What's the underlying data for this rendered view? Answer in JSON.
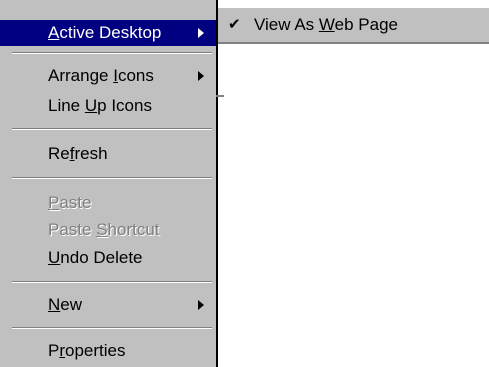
{
  "context_menu": {
    "active_desktop": {
      "prefix": "",
      "hotkey": "A",
      "rest": "ctive Desktop"
    },
    "arrange_icons": {
      "prefix": "Arrange ",
      "hotkey": "I",
      "rest": "cons"
    },
    "line_up_icons": {
      "prefix": "Line ",
      "hotkey": "U",
      "rest": "p Icons"
    },
    "refresh": {
      "prefix": "Re",
      "hotkey": "f",
      "rest": "resh"
    },
    "paste": {
      "prefix": "",
      "hotkey": "P",
      "rest": "aste"
    },
    "paste_shortcut": {
      "prefix": "Paste ",
      "hotkey": "S",
      "rest": "hortcut"
    },
    "undo_delete": {
      "prefix": "",
      "hotkey": "U",
      "rest": "ndo Delete"
    },
    "new": {
      "prefix": "",
      "hotkey": "N",
      "rest": "ew"
    },
    "properties": {
      "prefix": "P",
      "hotkey": "r",
      "rest": "operties"
    }
  },
  "submenu": {
    "check_glyph": "✔",
    "view_as_web_page": {
      "prefix": "View As ",
      "hotkey": "W",
      "rest": "eb Page"
    }
  },
  "colors": {
    "menu_bg": "#c0c0c0",
    "highlight": "#000080",
    "disabled_text": "#808080"
  }
}
